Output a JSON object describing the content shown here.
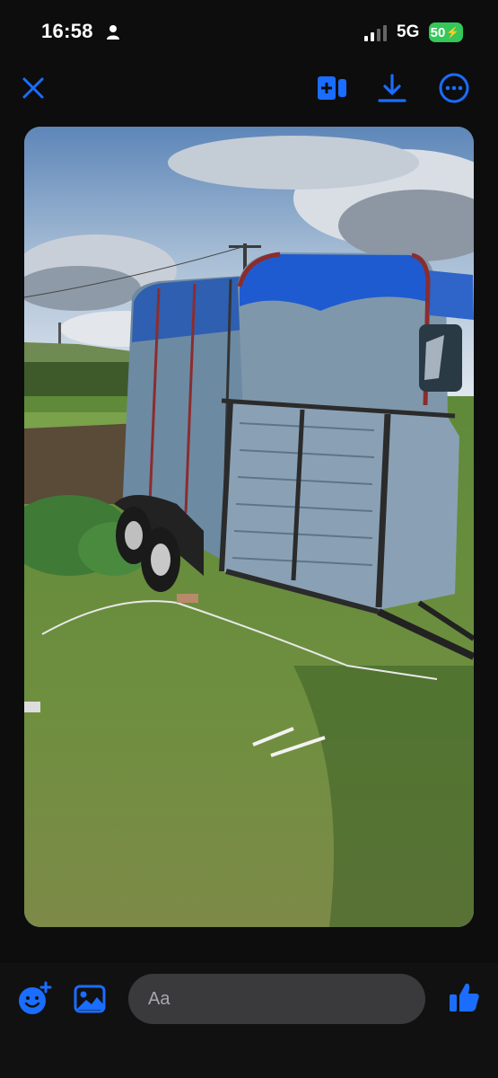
{
  "status_bar": {
    "time": "16:58",
    "network": "5G",
    "battery": "50",
    "battery_color": "#34c759"
  },
  "toolbar": {
    "accent_color": "#1a6dff",
    "icons": [
      "close-icon",
      "add-to-album-icon",
      "download-icon",
      "more-options-icon"
    ]
  },
  "photo": {
    "icon": "photo-of-horse-trailer-in-field"
  },
  "composer": {
    "placeholder": "Aa",
    "icons": [
      "add-sticker-icon",
      "gallery-icon",
      "like-thumbs-up-icon"
    ]
  }
}
